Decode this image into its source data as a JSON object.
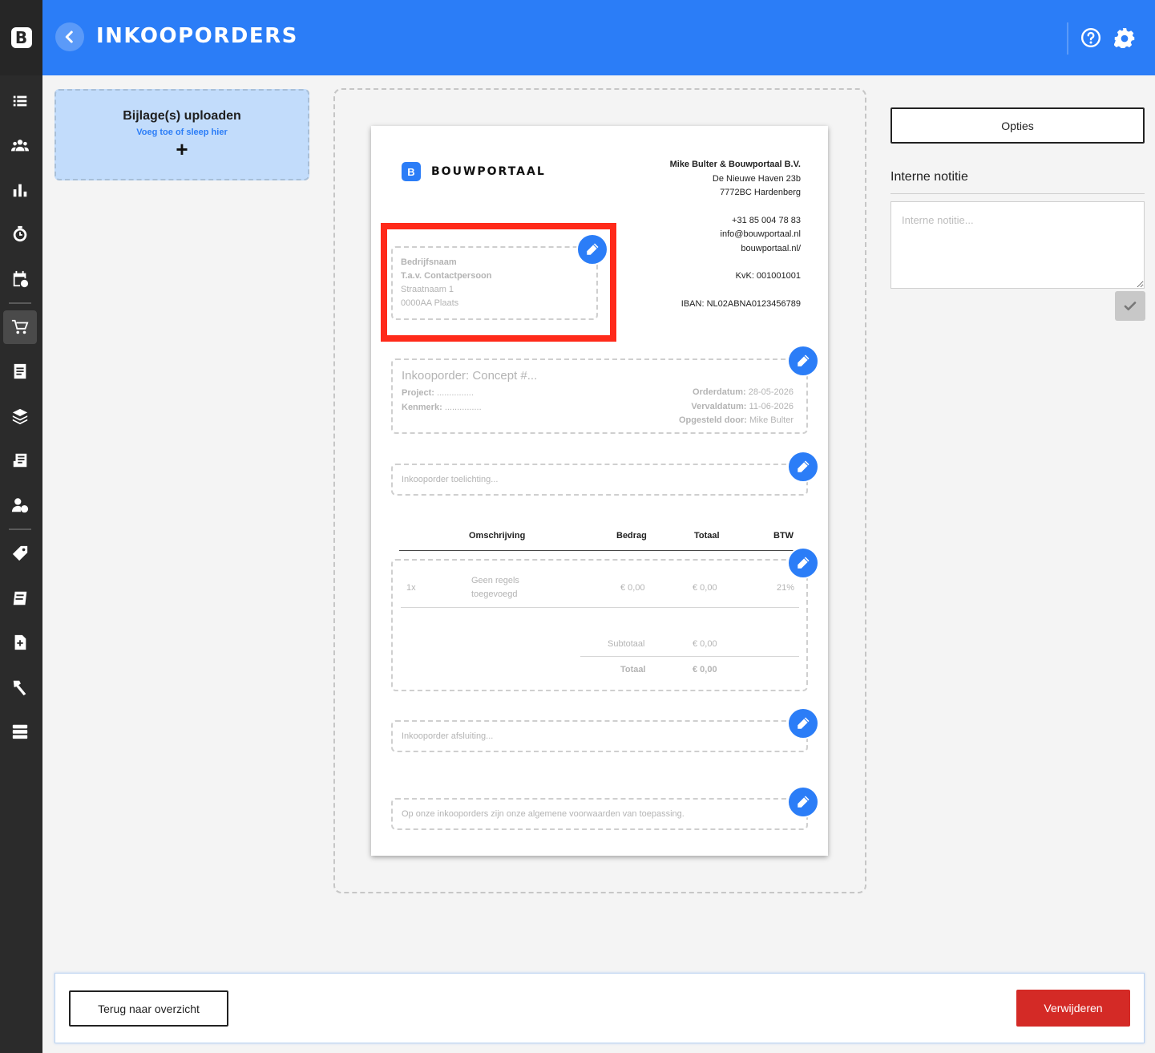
{
  "app": {
    "logo_letter": "B"
  },
  "header": {
    "title": "INKOOPORDERS",
    "back_icon": "chevron-left-icon",
    "help_icon": "help-circle-icon",
    "settings_icon": "gear-icon"
  },
  "sidebar": {
    "items": [
      {
        "icon": "list-icon",
        "active": false
      },
      {
        "icon": "users-icon",
        "active": false
      },
      {
        "icon": "bar-chart-icon",
        "active": false
      },
      {
        "icon": "timer-icon",
        "active": false
      },
      {
        "icon": "calendar-icon",
        "active": false
      },
      {
        "icon": "cart-icon",
        "active": true
      },
      {
        "icon": "receipt-icon",
        "active": false
      },
      {
        "icon": "layers-icon",
        "active": false
      },
      {
        "icon": "news-icon",
        "active": false
      },
      {
        "icon": "user-clock-icon",
        "active": false
      },
      {
        "icon": "tag-icon",
        "active": false
      },
      {
        "icon": "catalog-icon",
        "active": false
      },
      {
        "icon": "file-plus-icon",
        "active": false
      },
      {
        "icon": "tools-icon",
        "active": false
      },
      {
        "icon": "server-icon",
        "active": false
      }
    ]
  },
  "upload": {
    "title": "Bijlage(s) uploaden",
    "subtitle": "Voeg toe of sleep hier",
    "plus": "+"
  },
  "document": {
    "brand_mark": "B",
    "brand_name": "BOUWPORTAAL",
    "company": {
      "name": "Mike Bulter & Bouwportaal B.V.",
      "street": "De Nieuwe Haven 23b",
      "city": "7772BC Hardenberg",
      "phone": "+31 85 004 78 83",
      "email": "info@bouwportaal.nl",
      "website": "bouwportaal.nl/",
      "kvk": "KvK: 001001001",
      "iban": "IBAN: NL02ABNA0123456789"
    },
    "recipient": {
      "company": "Bedrijfsnaam",
      "contact": "T.a.v. Contactpersoon",
      "street": "Straatnaam 1",
      "city": "0000AA Plaats"
    },
    "order": {
      "title": "Inkooporder: Concept #...",
      "project_label": "Project:",
      "project_value": "...............",
      "kenmerk_label": "Kenmerk:",
      "kenmerk_value": "...............",
      "orderdatum_label": "Orderdatum:",
      "orderdatum_value": "28-05-2026",
      "vervaldatum_label": "Vervaldatum:",
      "vervaldatum_value": "11-06-2026",
      "opgesteld_label": "Opgesteld door:",
      "opgesteld_value": "Mike Bulter"
    },
    "toelichting_placeholder": "Inkooporder toelichting...",
    "table": {
      "headers": {
        "omschrijving": "Omschrijving",
        "bedrag": "Bedrag",
        "totaal": "Totaal",
        "btw": "BTW"
      },
      "row": {
        "qty": "1x",
        "desc_line1": "Geen regels",
        "desc_line2": "toegevoegd",
        "bedrag": "€ 0,00",
        "totaal": "€ 0,00",
        "btw": "21%"
      },
      "subtotal_label": "Subtotaal",
      "subtotal_value": "€ 0,00",
      "total_label": "Totaal",
      "total_value": "€ 0,00"
    },
    "afsluiting_placeholder": "Inkooporder afsluiting...",
    "voorwaarden": "Op onze inkooporders zijn onze algemene voorwaarden van toepassing."
  },
  "right": {
    "options_label": "Opties",
    "note_title": "Interne notitie",
    "note_placeholder": "Interne notitie...",
    "note_value": ""
  },
  "footer": {
    "back_label": "Terug naar overzicht",
    "delete_label": "Verwijderen"
  },
  "colors": {
    "primary": "#2b7df7",
    "danger": "#d42a26",
    "highlight": "#ff2a1a",
    "sidebar": "#2b2b2b"
  }
}
